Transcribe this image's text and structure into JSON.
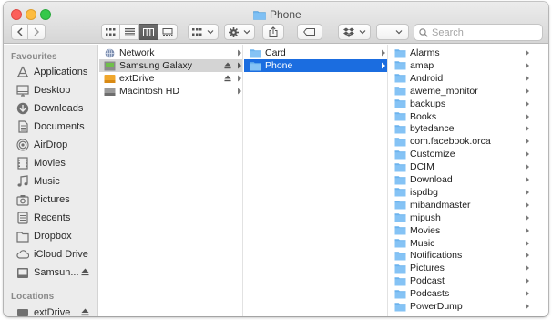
{
  "window": {
    "title": "Phone"
  },
  "toolbar": {
    "search_placeholder": "Search",
    "icons": {
      "back": "chevron-left-icon",
      "forward": "chevron-right-icon",
      "views": [
        "icon-view-icon",
        "list-view-icon",
        "column-view-icon",
        "gallery-view-icon"
      ],
      "active_view": "column-view-icon",
      "group": "group-by-icon",
      "action": "gear-icon",
      "share": "share-icon",
      "tags": "tag-icon",
      "dropbox": "dropbox-icon",
      "search": "search-icon"
    }
  },
  "sidebar": {
    "favourites_heading": "Favourites",
    "locations_heading": "Locations",
    "items": [
      {
        "label": "Applications",
        "icon": "applications-icon"
      },
      {
        "label": "Desktop",
        "icon": "desktop-icon"
      },
      {
        "label": "Downloads",
        "icon": "downloads-icon"
      },
      {
        "label": "Documents",
        "icon": "documents-icon"
      },
      {
        "label": "AirDrop",
        "icon": "airdrop-icon"
      },
      {
        "label": "Movies",
        "icon": "movies-icon"
      },
      {
        "label": "Music",
        "icon": "music-icon"
      },
      {
        "label": "Pictures",
        "icon": "pictures-icon"
      },
      {
        "label": "Recents",
        "icon": "recents-icon"
      },
      {
        "label": "Dropbox",
        "icon": "dropbox-folder-icon"
      },
      {
        "label": "iCloud Drive",
        "icon": "icloud-icon"
      },
      {
        "label": "Samsun...",
        "icon": "device-icon"
      }
    ],
    "location_items": [
      {
        "label": "extDrive",
        "icon": "drive-icon"
      }
    ]
  },
  "columns": {
    "col1": [
      {
        "label": "Network",
        "icon": "network-icon"
      },
      {
        "label": "Samsung Galaxy",
        "icon": "phone-device-icon",
        "selected": true
      },
      {
        "label": "extDrive",
        "icon": "external-drive-icon"
      },
      {
        "label": "Macintosh HD",
        "icon": "hard-drive-icon"
      }
    ],
    "col2": [
      {
        "label": "Card"
      },
      {
        "label": "Phone",
        "selected": true
      }
    ],
    "col3": [
      "Alarms",
      "amap",
      "Android",
      "aweme_monitor",
      "backups",
      "Books",
      "bytedance",
      "com.facebook.orca",
      "Customize",
      "DCIM",
      "Download",
      "ispdbg",
      "mibandmaster",
      "mipush",
      "Movies",
      "Music",
      "Notifications",
      "Pictures",
      "Podcast",
      "Podcasts",
      "PowerDump"
    ]
  },
  "colors": {
    "accent": "#1b6de0",
    "folder": "#6cb3ee",
    "sidebar_bg": "#ececec",
    "selected_inactive": "#d4d4d4"
  }
}
